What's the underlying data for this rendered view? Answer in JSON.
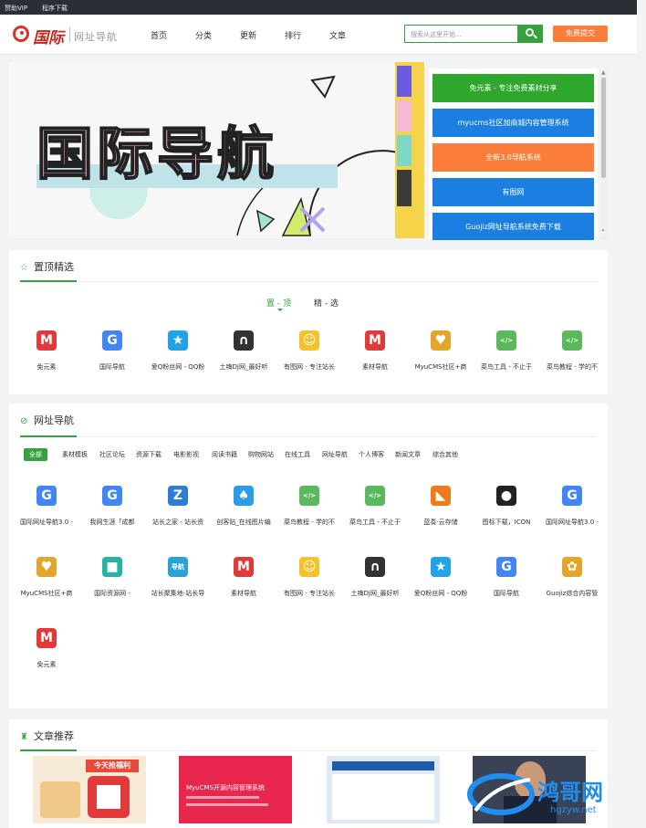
{
  "topbar": {
    "vip": "赞助VIP",
    "download": "程序下载"
  },
  "header": {
    "logo_main": "国际",
    "logo_sub": "网址导航",
    "nav": [
      "首页",
      "分类",
      "更新",
      "排行",
      "文章"
    ],
    "search_placeholder": "搜索从这里开始...",
    "submit_label": "免费提交"
  },
  "banner": {
    "title": "国际导航"
  },
  "side_list": [
    {
      "label": "免元素 - 专注免费素材分享",
      "color": "#2ea72c"
    },
    {
      "label": "myucms社区加商城内容管理系统",
      "color": "#1a7fe0"
    },
    {
      "label": "全新3.0导航系统",
      "color": "#fb7d3a"
    },
    {
      "label": "有图网",
      "color": "#1a7fe0"
    },
    {
      "label": "Guojiz网址导航系统免费下载",
      "color": "#1a7fe0"
    }
  ],
  "pinned": {
    "title": "置顶精选",
    "tabs": [
      "置 - 顶",
      "精 - 选"
    ],
    "sites": [
      {
        "label": "免元素",
        "icon": "ms-logo-icon",
        "color": "#e23a3a",
        "glyph": "M"
      },
      {
        "label": "国际导航",
        "icon": "google-g-icon",
        "color": "#4285f4",
        "glyph": "G"
      },
      {
        "label": "爱Q粉丝网 - QQ粉",
        "icon": "star-icon",
        "color": "#22a2e8",
        "glyph": "★"
      },
      {
        "label": "土嗨DJ网_最好听",
        "icon": "headphones-icon",
        "color": "#333333",
        "glyph": "∩"
      },
      {
        "label": "有图网 - 专注站长",
        "icon": "cartoon-icon",
        "color": "#f5c22b",
        "glyph": "☺"
      },
      {
        "label": "素材导航",
        "icon": "ms-logo-icon",
        "color": "#e23a3a",
        "glyph": "M"
      },
      {
        "label": "MyuCMS社区+商",
        "icon": "heart-icon",
        "color": "#e4a62a",
        "glyph": "♥"
      },
      {
        "label": "菜鸟工具 - 不止于",
        "icon": "code-icon",
        "color": "#5cb85c",
        "glyph": "</>"
      },
      {
        "label": "菜鸟教程 - 学的不",
        "icon": "code-icon",
        "color": "#5cb85c",
        "glyph": "</>"
      }
    ]
  },
  "directory": {
    "title": "网址导航",
    "chips": [
      "全部",
      "素材模板",
      "社区论坛",
      "资源下载",
      "电影影视",
      "阅读书籍",
      "购物网站",
      "在线工具",
      "网址导航",
      "个人博客",
      "新闻文章",
      "综合其他"
    ],
    "row1": [
      {
        "label": "国际网址导航3.0 -",
        "icon": "google-g-icon",
        "color": "#4285f4",
        "glyph": "G"
      },
      {
        "label": "我网生涯「成都",
        "icon": "google-g-icon",
        "color": "#4285f4",
        "glyph": "G"
      },
      {
        "label": "站长之家 - 站长资",
        "icon": "chinaz-icon",
        "color": "#2a7fd4",
        "glyph": "Z"
      },
      {
        "label": "创客贴_在线图片编",
        "icon": "bird-icon",
        "color": "#2a9ce8",
        "glyph": "♠"
      },
      {
        "label": "菜鸟教程 - 学的不",
        "icon": "code-icon",
        "color": "#5cb85c",
        "glyph": "</>"
      },
      {
        "label": "菜鸟工具 - 不止于",
        "icon": "code-icon",
        "color": "#5cb85c",
        "glyph": "</>"
      },
      {
        "label": "蓝奏·云存储",
        "icon": "flag-icon",
        "color": "#f07a1a",
        "glyph": "◣"
      },
      {
        "label": "图标下载，ICON",
        "icon": "panda-icon",
        "color": "#222222",
        "glyph": "●"
      },
      {
        "label": "国际网址导航3.0 -",
        "icon": "google-g-icon",
        "color": "#4285f4",
        "glyph": "G"
      }
    ],
    "row2": [
      {
        "label": "MyuCMS社区+商",
        "icon": "heart-icon",
        "color": "#e4a62a",
        "glyph": "♥"
      },
      {
        "label": "国际资源网 -",
        "icon": "cube-icon",
        "color": "#26b3a6",
        "glyph": "■"
      },
      {
        "label": "站长聚集地-站长导",
        "icon": "daohang-icon",
        "color": "#2aa2d6",
        "glyph": "导航"
      },
      {
        "label": "素材导航",
        "icon": "ms-logo-icon",
        "color": "#e23a3a",
        "glyph": "M"
      },
      {
        "label": "有图网 - 专注站长",
        "icon": "cartoon-icon",
        "color": "#f5c22b",
        "glyph": "☺"
      },
      {
        "label": "土嗨DJ网_最好听",
        "icon": "headphones-icon",
        "color": "#333333",
        "glyph": "∩"
      },
      {
        "label": "爱Q粉丝网 - QQ粉",
        "icon": "star-icon",
        "color": "#22a2e8",
        "glyph": "★"
      },
      {
        "label": "国际导航",
        "icon": "google-g-icon",
        "color": "#4285f4",
        "glyph": "G"
      },
      {
        "label": "Guojiz综合内容管",
        "icon": "swirl-icon",
        "color": "#e4a62a",
        "glyph": "✿"
      }
    ],
    "row3": [
      {
        "label": "免元素",
        "icon": "ms-logo-icon",
        "color": "#e23a3a",
        "glyph": "M"
      }
    ]
  },
  "articles": {
    "title": "文章推荐",
    "thumb2_title": "MyuCMS开源内容管理系统",
    "thumb1_text": "今天抢福利",
    "watermark_main": "鸿哥网",
    "watermark_sub": "hgzyw.net"
  }
}
